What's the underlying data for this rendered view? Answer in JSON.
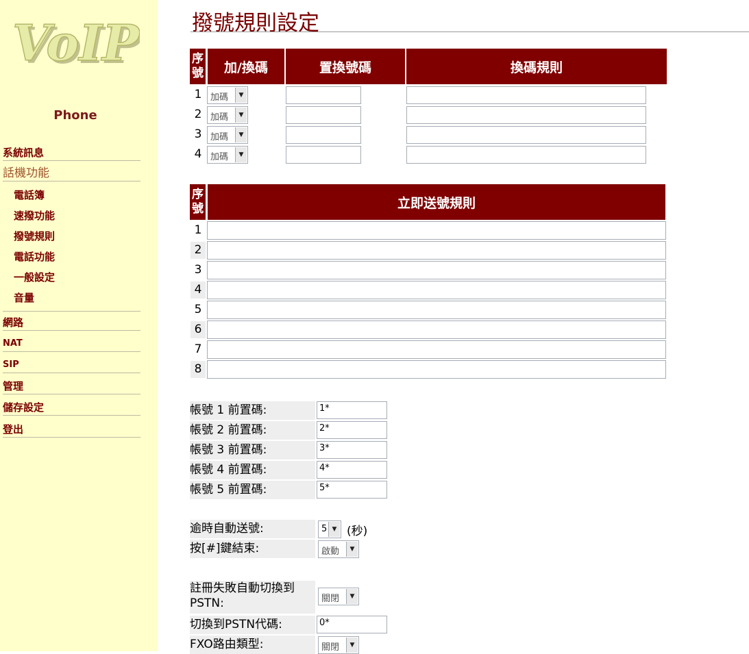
{
  "sidebar": {
    "logo_text": "VoIP",
    "product": "Phone",
    "items": [
      {
        "label": "系統訊息"
      },
      {
        "label": "話機功能"
      },
      {
        "label": "電話簿"
      },
      {
        "label": "速撥功能"
      },
      {
        "label": "撥號規則"
      },
      {
        "label": "電話功能"
      },
      {
        "label": "一般設定"
      },
      {
        "label": "音量"
      },
      {
        "label": "網路"
      },
      {
        "label": "NAT"
      },
      {
        "label": "SIP"
      },
      {
        "label": "管理"
      },
      {
        "label": "儲存設定"
      },
      {
        "label": "登出"
      }
    ]
  },
  "page_title": "撥號規則設定",
  "table1": {
    "headers": [
      "序號",
      "加/換碼",
      "置換號碼",
      "換碼規則"
    ],
    "rows": [
      {
        "num": "1",
        "mode": "加碼",
        "replace": "",
        "rule": ""
      },
      {
        "num": "2",
        "mode": "加碼",
        "replace": "",
        "rule": ""
      },
      {
        "num": "3",
        "mode": "加碼",
        "replace": "",
        "rule": ""
      },
      {
        "num": "4",
        "mode": "加碼",
        "replace": "",
        "rule": ""
      }
    ]
  },
  "table2": {
    "headers": [
      "序號",
      "立即送號規則"
    ],
    "rows": [
      {
        "num": "1",
        "rule": ""
      },
      {
        "num": "2",
        "rule": ""
      },
      {
        "num": "3",
        "rule": ""
      },
      {
        "num": "4",
        "rule": ""
      },
      {
        "num": "5",
        "rule": ""
      },
      {
        "num": "6",
        "rule": ""
      },
      {
        "num": "7",
        "rule": ""
      },
      {
        "num": "8",
        "rule": ""
      }
    ]
  },
  "prefixes": [
    {
      "label": "帳號 1 前置碼:",
      "value": "1*"
    },
    {
      "label": "帳號 2 前置碼:",
      "value": "2*"
    },
    {
      "label": "帳號 3 前置碼:",
      "value": "3*"
    },
    {
      "label": "帳號 4 前置碼:",
      "value": "4*"
    },
    {
      "label": "帳號 5 前置碼:",
      "value": "5*"
    }
  ],
  "timeout": {
    "label": "逾時自動送號:",
    "value": "5",
    "unit": "(秒)"
  },
  "hash_end": {
    "label": "按[#]鍵結束:",
    "value": "啟動"
  },
  "pstn_fallback": {
    "label_line1": "註冊失敗自動切換到",
    "label_line2": "PSTN:",
    "value": "關閉"
  },
  "pstn_code": {
    "label": "切換到PSTN代碼:",
    "value": "0*"
  },
  "fxo_route": {
    "label": "FXO路由類型:",
    "value": "關閉"
  }
}
